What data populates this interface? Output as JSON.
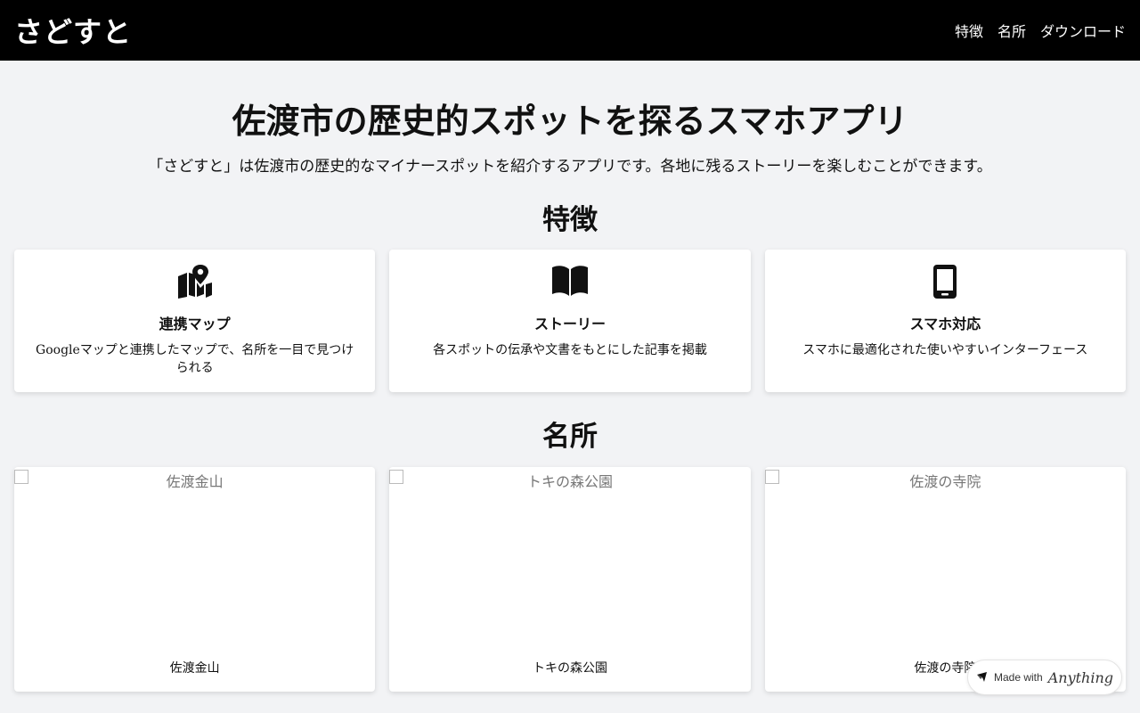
{
  "header": {
    "brand": "さどすと",
    "nav": [
      "特徴",
      "名所",
      "ダウンロード"
    ]
  },
  "hero": {
    "title": "佐渡市の歴史的スポットを探るスマホアプリ",
    "subtitle": "「さどすと」は佐渡市の歴史的なマイナースポットを紹介するアプリです。各地に残るストーリーを楽しむことができます。"
  },
  "features": {
    "title": "特徴",
    "items": [
      {
        "icon": "map-location-icon",
        "title": "連携マップ",
        "desc": "Googleマップと連携したマップで、名所を一目で見つけられる"
      },
      {
        "icon": "book-open-icon",
        "title": "ストーリー",
        "desc": "各スポットの伝承や文書をもとにした記事を掲載"
      },
      {
        "icon": "smartphone-icon",
        "title": "スマホ対応",
        "desc": "スマホに最適化された使いやすいインターフェース"
      }
    ]
  },
  "spots": {
    "title": "名所",
    "items": [
      {
        "alt": "佐渡金山",
        "name": "佐渡金山"
      },
      {
        "alt": "トキの森公園",
        "name": "トキの森公園"
      },
      {
        "alt": "佐渡の寺院",
        "name": "佐渡の寺院"
      }
    ]
  },
  "badge": {
    "prefix": "Made with",
    "brand": "Anything"
  }
}
